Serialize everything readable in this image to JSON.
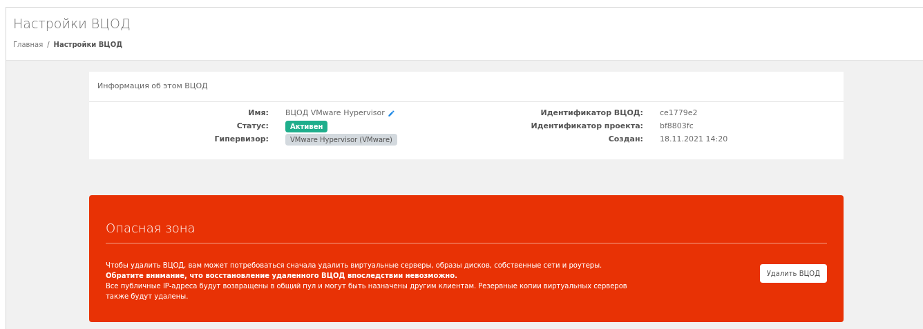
{
  "page": {
    "title": "Настройки ВЦОД",
    "breadcrumb_separator": "/",
    "breadcrumbs": [
      {
        "label": "Главная",
        "current": false
      },
      {
        "label": "Настройки ВЦОД",
        "current": true
      }
    ]
  },
  "info": {
    "title": "Информация об этом ВЦОД",
    "left": [
      {
        "label": "Имя:",
        "value": "ВЦОД VMware Hypervisor",
        "kind": "editable"
      },
      {
        "label": "Статус:",
        "value": "Активен",
        "kind": "success-badge"
      },
      {
        "label": "Гипервизор:",
        "value": "VMware Hypervisor (VMware)",
        "kind": "neutral-badge"
      }
    ],
    "right": [
      {
        "label": "Идентификатор ВЦОД:",
        "value": "ce1779e2",
        "kind": "text"
      },
      {
        "label": "Идентификатор проекта:",
        "value": "bf8803fc",
        "kind": "text"
      },
      {
        "label": "Создан:",
        "value": "18.11.2021 14:20",
        "kind": "text"
      }
    ]
  },
  "danger": {
    "title": "Опасная зона",
    "paragraphs": [
      {
        "text": "Чтобы удалить ВЦОД, вам может потребоваться сначала удалить виртуальные серверы, образы дисков, собственные сети и роутеры.",
        "bold": false
      },
      {
        "text": "Обратите внимание, что восстановление удаленного ВЦОД впоследствии невозможно.",
        "bold": true
      },
      {
        "text": "Все публичные IP-адреса будут возвращены в общий пул и могут быть назначены другим клиентам. Резервные копии виртуальных серверов также будут удалены.",
        "bold": false
      }
    ],
    "button": "Удалить ВЦОД"
  }
}
